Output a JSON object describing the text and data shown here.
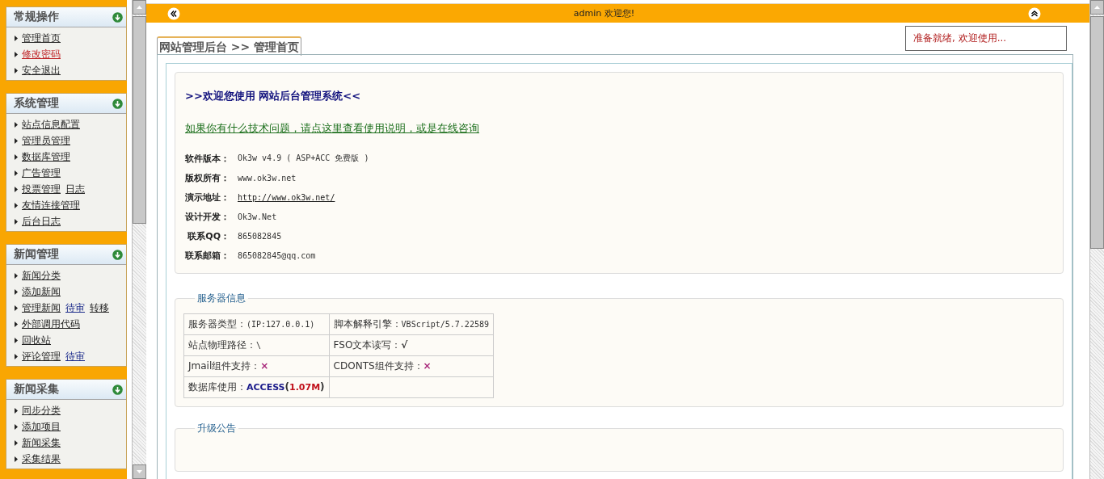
{
  "sidebar": {
    "panels": [
      {
        "title": "常规操作",
        "items": [
          {
            "links": [
              {
                "text": "管理首页",
                "kind": "default"
              }
            ]
          },
          {
            "links": [
              {
                "text": "修改密码",
                "kind": "highlight"
              }
            ]
          },
          {
            "links": [
              {
                "text": "安全退出",
                "kind": "default"
              }
            ]
          }
        ]
      },
      {
        "title": "系统管理",
        "items": [
          {
            "links": [
              {
                "text": "站点信息配置",
                "kind": "default"
              }
            ]
          },
          {
            "links": [
              {
                "text": "管理员管理",
                "kind": "default"
              }
            ]
          },
          {
            "links": [
              {
                "text": "数据库管理",
                "kind": "default"
              }
            ]
          },
          {
            "links": [
              {
                "text": "广告管理",
                "kind": "default"
              }
            ]
          },
          {
            "links": [
              {
                "text": "投票管理",
                "kind": "default"
              },
              {
                "text": "日志",
                "kind": "default"
              }
            ]
          },
          {
            "links": [
              {
                "text": "友情连接管理",
                "kind": "default"
              }
            ]
          },
          {
            "links": [
              {
                "text": "后台日志",
                "kind": "default"
              }
            ]
          }
        ]
      },
      {
        "title": "新闻管理",
        "items": [
          {
            "links": [
              {
                "text": "新闻分类",
                "kind": "default"
              }
            ]
          },
          {
            "links": [
              {
                "text": "添加新闻",
                "kind": "default"
              }
            ]
          },
          {
            "links": [
              {
                "text": "管理新闻",
                "kind": "default"
              },
              {
                "text": "待审",
                "kind": "pending"
              },
              {
                "text": "转移",
                "kind": "default"
              }
            ]
          },
          {
            "links": [
              {
                "text": "外部调用代码",
                "kind": "default"
              }
            ]
          },
          {
            "links": [
              {
                "text": "回收站",
                "kind": "default"
              }
            ]
          },
          {
            "links": [
              {
                "text": "评论管理",
                "kind": "default"
              },
              {
                "text": "待审",
                "kind": "pending"
              }
            ]
          }
        ]
      },
      {
        "title": "新闻采集",
        "items": [
          {
            "links": [
              {
                "text": "同步分类",
                "kind": "default"
              }
            ]
          },
          {
            "links": [
              {
                "text": "添加项目",
                "kind": "default"
              }
            ]
          },
          {
            "links": [
              {
                "text": "新闻采集",
                "kind": "default"
              }
            ]
          },
          {
            "links": [
              {
                "text": "采集结果",
                "kind": "default"
              }
            ]
          }
        ]
      }
    ]
  },
  "top_bar": {
    "greeting": "admin 欢迎您!"
  },
  "status_box": "准备就绪, 欢迎使用...",
  "breadcrumb_tab": "网站管理后台 >> 管理首页",
  "welcome": {
    "heading": ">>欢迎您使用 网站后台管理系统<<",
    "help_link": "如果你有什么技术问题，请点这里查看使用说明，或是在线咨询",
    "info": [
      {
        "label": "软件版本：",
        "value": "Ok3w v4.9 ( ASP+ACC 免费版 )",
        "kind": "text"
      },
      {
        "label": "版权所有：",
        "value": "www.ok3w.net",
        "kind": "text"
      },
      {
        "label": "演示地址：",
        "value": "http://www.ok3w.net/",
        "kind": "link"
      },
      {
        "label": "设计开发：",
        "value": "Ok3w.Net",
        "kind": "text"
      },
      {
        "label": "联系QQ：",
        "value": "865082845",
        "kind": "text"
      },
      {
        "label": "联系邮箱：",
        "value": "865082845@qq.com",
        "kind": "text"
      }
    ]
  },
  "server_info": {
    "legend": "服务器信息",
    "rows": [
      [
        {
          "label": "服务器类型：",
          "parts": [
            {
              "text": "(IP:127.0.0.1)",
              "kind": "plain"
            }
          ]
        },
        {
          "label": "脚本解释引擎：",
          "parts": [
            {
              "text": "VBScript/5.7.22589",
              "kind": "plain"
            }
          ]
        }
      ],
      [
        {
          "label": "站点物理路径：",
          "parts": [
            {
              "text": "\\",
              "kind": "plain"
            }
          ]
        },
        {
          "label": "FSO文本读写：",
          "parts": [
            {
              "text": "√",
              "kind": "yes"
            }
          ]
        }
      ],
      [
        {
          "label": "Jmail组件支持：",
          "parts": [
            {
              "text": "×",
              "kind": "no"
            }
          ]
        },
        {
          "label": "CDONTS组件支持：",
          "parts": [
            {
              "text": "×",
              "kind": "no"
            }
          ]
        }
      ],
      [
        {
          "label": "数据库使用：",
          "parts": [
            {
              "text": "ACCESS",
              "kind": "db"
            },
            {
              "text": "(",
              "kind": "bold"
            },
            {
              "text": "1.07M",
              "kind": "size"
            },
            {
              "text": ")",
              "kind": "bold"
            }
          ]
        },
        null
      ]
    ]
  },
  "upgrade": {
    "legend": "升级公告"
  }
}
